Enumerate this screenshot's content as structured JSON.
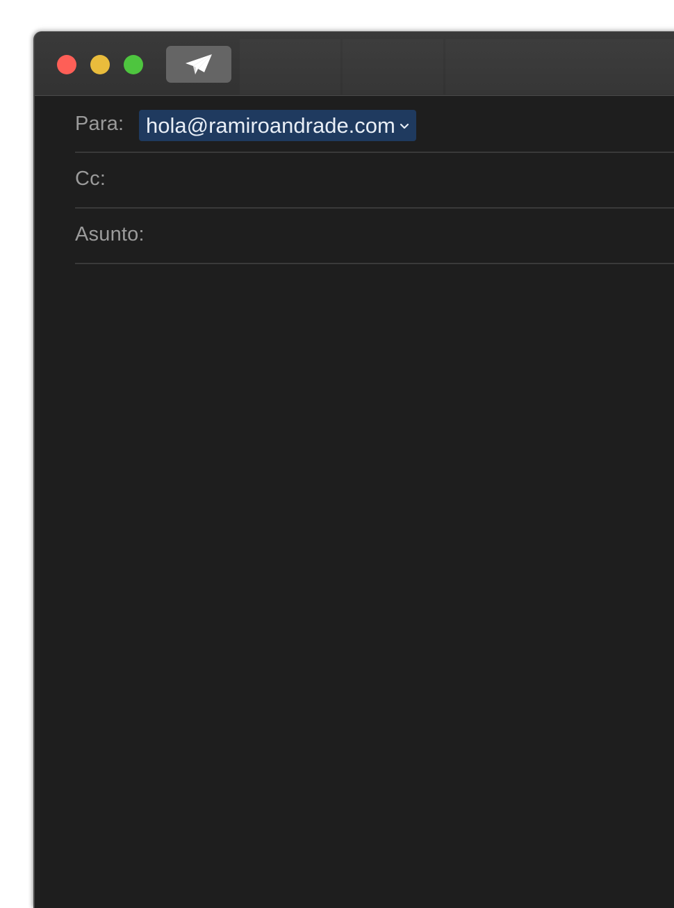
{
  "window": {
    "controls": {
      "close": "close-button",
      "minimize": "minimize-button",
      "zoom": "zoom-button"
    },
    "toolbar": {
      "send_icon": "paper-plane-icon"
    }
  },
  "compose": {
    "to_label": "Para:",
    "to_recipient": "hola@ramiroandrade.com",
    "cc_label": "Cc:",
    "cc_value": "",
    "subject_label": "Asunto:",
    "subject_value": "",
    "body": ""
  },
  "colors": {
    "window_bg": "#1e1e1e",
    "titlebar_bg": "#353535",
    "close": "#fe5f57",
    "minimize": "#e9bc3c",
    "zoom": "#4ec53f",
    "recipient_token_bg": "#1f3a5f",
    "label": "#9b9b9b"
  }
}
